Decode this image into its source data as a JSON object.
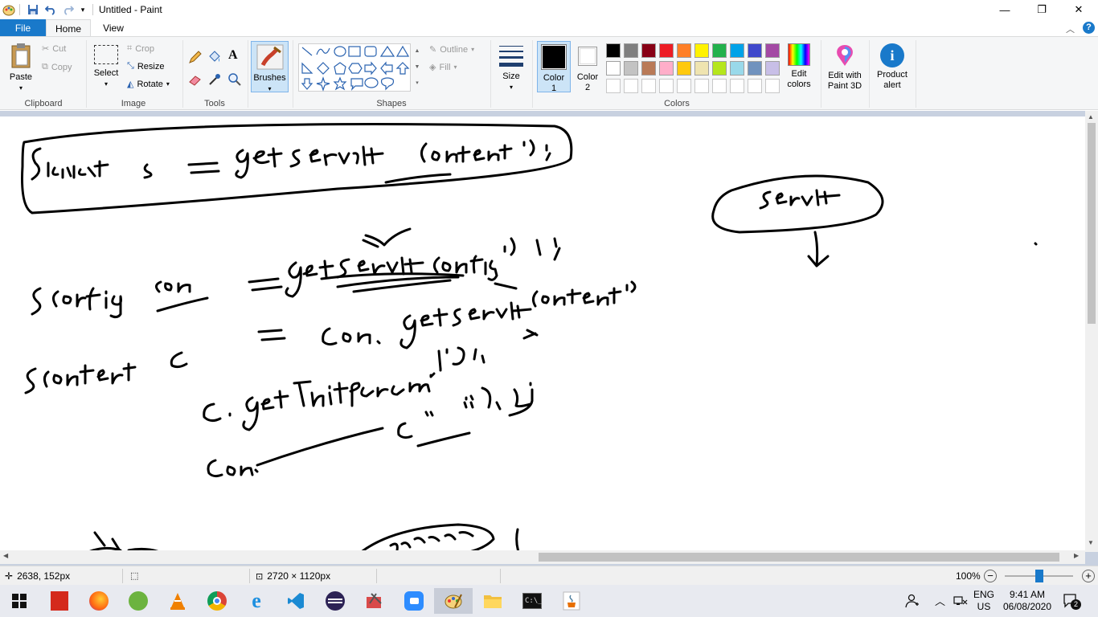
{
  "window": {
    "title": "Untitled - Paint",
    "controls": {
      "minimize": "—",
      "maximize": "❐",
      "close": "✕"
    }
  },
  "tabs": {
    "file": "File",
    "home": "Home",
    "view": "View"
  },
  "ribbon": {
    "clipboard": {
      "label": "Clipboard",
      "paste": "Paste",
      "cut": "Cut",
      "copy": "Copy"
    },
    "image": {
      "label": "Image",
      "select": "Select",
      "crop": "Crop",
      "resize": "Resize",
      "rotate": "Rotate"
    },
    "tools": {
      "label": "Tools"
    },
    "brushes": {
      "label": "Brushes"
    },
    "shapes": {
      "label": "Shapes",
      "outline": "Outline",
      "fill": "Fill"
    },
    "size": {
      "label": "Size"
    },
    "colors": {
      "label": "Colors",
      "color1_line1": "Color",
      "color1_line2": "1",
      "color2_line1": "Color",
      "color2_line2": "2",
      "color1_value": "#000000",
      "color2_value": "#ffffff",
      "palette_row1": [
        "#000000",
        "#7f7f7f",
        "#880015",
        "#ed1c24",
        "#ff7f27",
        "#fff200",
        "#22b14c",
        "#00a2e8",
        "#3f48cc",
        "#a349a4"
      ],
      "palette_row2": [
        "#ffffff",
        "#c3c3c3",
        "#b97a57",
        "#ffaec9",
        "#ffc90e",
        "#efe4b0",
        "#b5e61d",
        "#99d9ea",
        "#7092be",
        "#c8bfe7"
      ],
      "edit_line1": "Edit",
      "edit_line2": "colors",
      "paint3d_line1": "Edit with",
      "paint3d_line2": "Paint 3D",
      "alert_line1": "Product",
      "alert_line2": "alert"
    }
  },
  "status": {
    "cursor": "2638, 152px",
    "canvas_size": "2720 × 1120px",
    "zoom": "100%",
    "zoom_level_fraction": 0.5
  },
  "taskbar": {
    "lang_line1": "ENG",
    "lang_line2": "US",
    "time": "9:41 AM",
    "date": "06/08/2020",
    "notifications": "2"
  }
}
